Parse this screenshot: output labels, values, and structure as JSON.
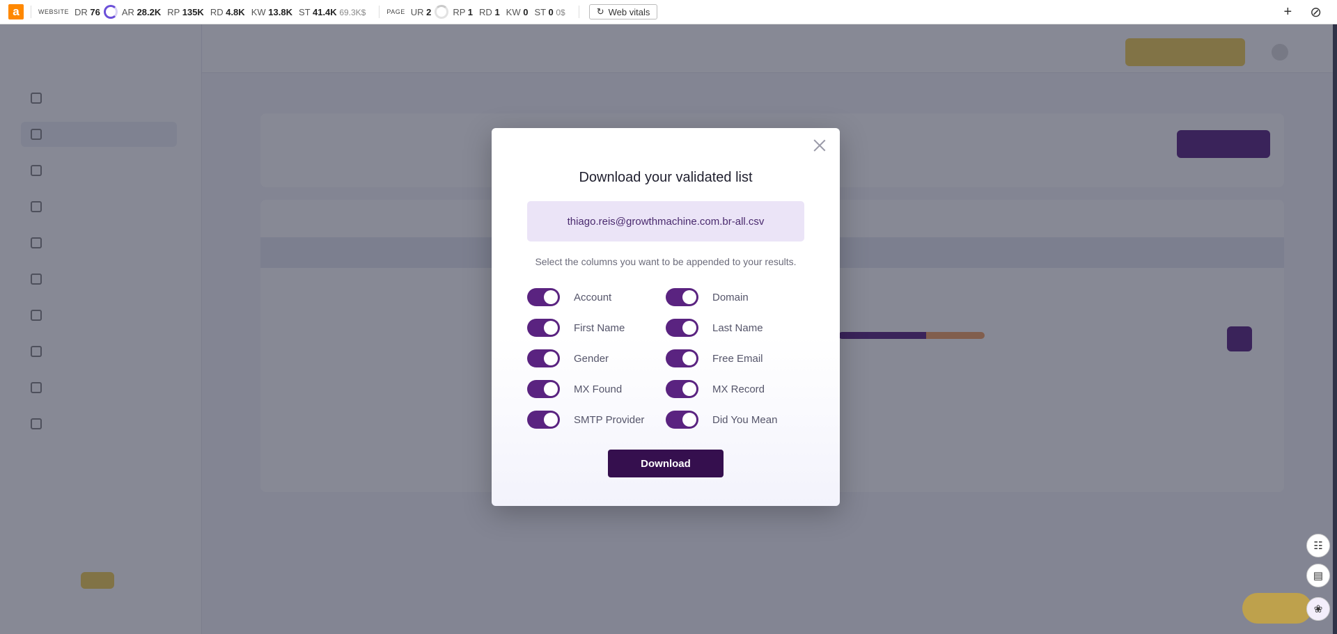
{
  "toolbar": {
    "website_caption": "WEBSITE",
    "dr_label": "DR",
    "dr_value": "76",
    "ar_label": "AR",
    "ar_value": "28.2K",
    "rp_label": "RP",
    "rp_value": "135K",
    "rd_label": "RD",
    "rd_value": "4.8K",
    "kw_label": "KW",
    "kw_value": "13.8K",
    "st_label": "ST",
    "st_value": "41.4K",
    "st_cost": "69.3K$",
    "page_caption": "PAGE",
    "ur_label": "UR",
    "ur_value": "2",
    "prp_label": "RP",
    "prp_value": "1",
    "prd_label": "RD",
    "prd_value": "1",
    "pkw_label": "KW",
    "pkw_value": "0",
    "pst_label": "ST",
    "pst_value": "0",
    "pst_cost": "0$",
    "web_vitals_label": "Web vitals",
    "icons": [
      "ahrefs-logo",
      "refresh-icon",
      "plus-icon",
      "block-icon"
    ]
  },
  "modal": {
    "title": "Download your validated list",
    "file_name": "thiago.reis@growthmachine.com.br-all.csv",
    "instructions": "Select the columns you want to be appended to your results.",
    "columns": [
      {
        "label": "Account",
        "enabled": true
      },
      {
        "label": "Domain",
        "enabled": true
      },
      {
        "label": "First Name",
        "enabled": true
      },
      {
        "label": "Last Name",
        "enabled": true
      },
      {
        "label": "Gender",
        "enabled": true
      },
      {
        "label": "Free Email",
        "enabled": true
      },
      {
        "label": "MX Found",
        "enabled": true
      },
      {
        "label": "MX Record",
        "enabled": true
      },
      {
        "label": "SMTP Provider",
        "enabled": true
      },
      {
        "label": "Did You Mean",
        "enabled": true
      }
    ],
    "download_label": "Download"
  },
  "colors": {
    "toggle_on": "#5a2380",
    "download_button": "#350f4e",
    "file_box": "#ebe4f7",
    "overlay": "#191c34"
  }
}
